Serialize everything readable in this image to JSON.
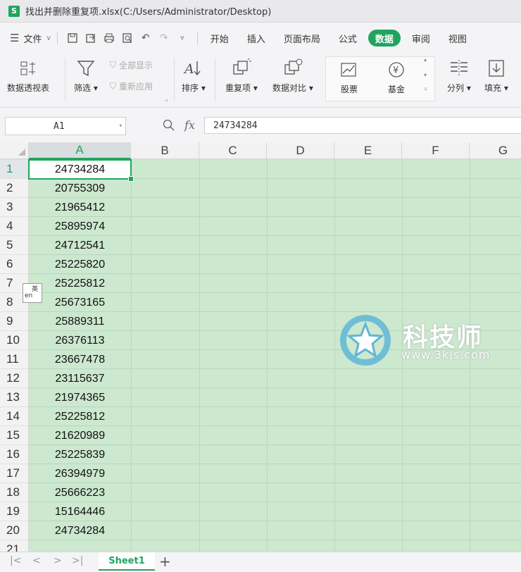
{
  "titlebar": {
    "app_icon": "S",
    "title": "找出并删除重复项.xlsx(C:/Users/Administrator/Desktop)"
  },
  "menubar": {
    "file_label": "文件",
    "tabs": [
      "开始",
      "插入",
      "页面布局",
      "公式",
      "数据",
      "审阅",
      "视图"
    ],
    "active_tab": "数据"
  },
  "ribbon": {
    "pivot": "数据透视表",
    "filter": "筛选",
    "show_all": "全部显示",
    "reapply": "重新应用",
    "sort": "排序",
    "duplicates": "重复项",
    "compare": "数据对比",
    "stock": "股票",
    "fund": "基金",
    "split": "分列",
    "fill": "填充"
  },
  "formula_bar": {
    "name_box": "A1",
    "fx": "fx",
    "value": "24734284"
  },
  "columns": [
    "A",
    "B",
    "C",
    "D",
    "E",
    "F",
    "G"
  ],
  "rows": [
    {
      "n": "1",
      "a": "24734284"
    },
    {
      "n": "2",
      "a": "20755309"
    },
    {
      "n": "3",
      "a": "21965412"
    },
    {
      "n": "4",
      "a": "25895974"
    },
    {
      "n": "5",
      "a": "24712541"
    },
    {
      "n": "6",
      "a": "25225820"
    },
    {
      "n": "7",
      "a": "25225812"
    },
    {
      "n": "8",
      "a": "25673165"
    },
    {
      "n": "9",
      "a": "25889311"
    },
    {
      "n": "10",
      "a": "26376113"
    },
    {
      "n": "11",
      "a": "23667478"
    },
    {
      "n": "12",
      "a": "23115637"
    },
    {
      "n": "13",
      "a": "21974365"
    },
    {
      "n": "14",
      "a": "25225812"
    },
    {
      "n": "15",
      "a": "21620989"
    },
    {
      "n": "16",
      "a": "25225839"
    },
    {
      "n": "17",
      "a": "26394979"
    },
    {
      "n": "18",
      "a": "25666223"
    },
    {
      "n": "19",
      "a": "15164446"
    },
    {
      "n": "20",
      "a": "24734284"
    },
    {
      "n": "21",
      "a": ""
    }
  ],
  "watermark": {
    "text": "科技师",
    "url": "www.3kjs.com"
  },
  "ime": {
    "line1": "英",
    "line2": "en"
  },
  "sheets": {
    "active": "Sheet1",
    "add": "+"
  },
  "colors": {
    "accent": "#1fa55d",
    "grid_bg": "#cce8cf"
  }
}
